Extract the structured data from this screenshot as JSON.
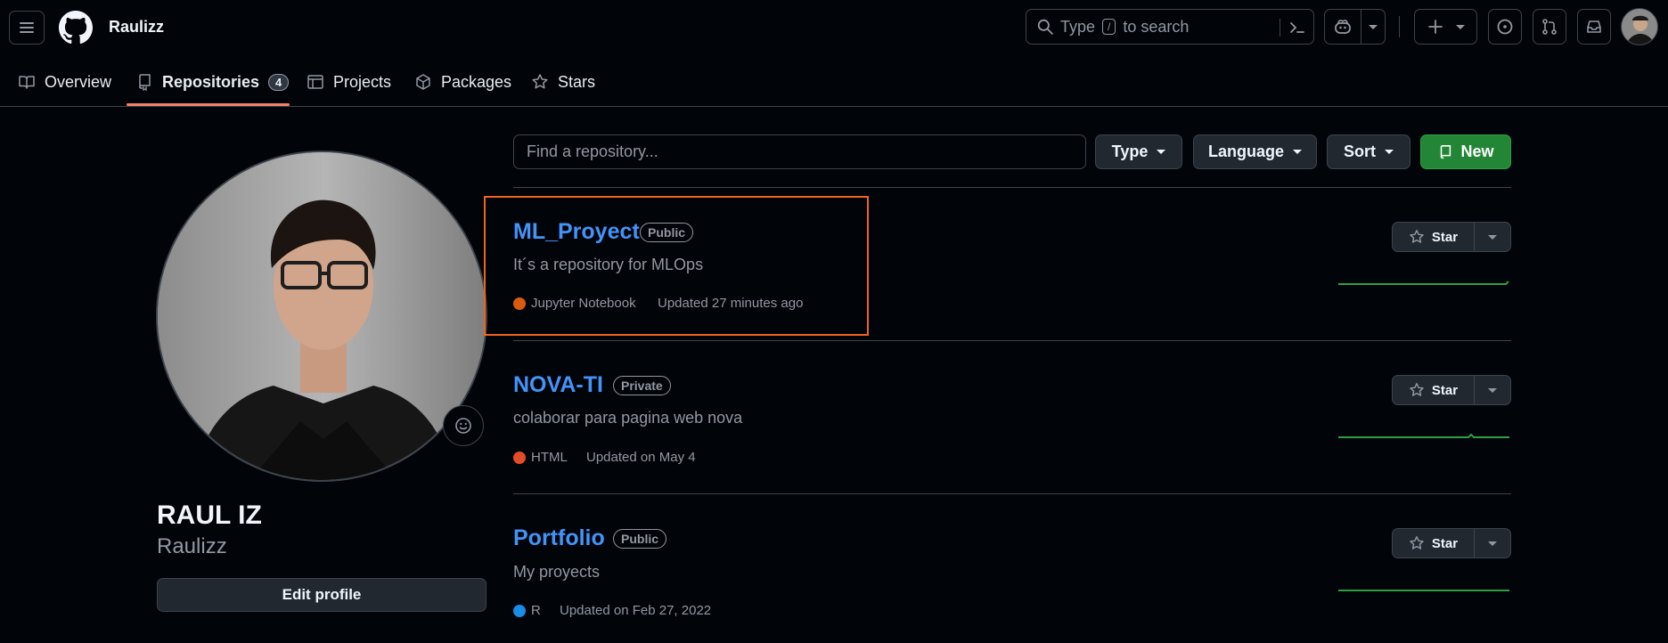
{
  "header": {
    "username": "Raulizz",
    "search_placeholder_pre": "Type",
    "search_key": "/",
    "search_placeholder_post": "to search"
  },
  "nav": {
    "overview": "Overview",
    "repositories": "Repositories",
    "repositories_count": "4",
    "projects": "Projects",
    "packages": "Packages",
    "stars": "Stars"
  },
  "profile": {
    "name": "RAUL IZ",
    "username": "Raulizz",
    "edit_button": "Edit profile"
  },
  "filters": {
    "find_placeholder": "Find a repository...",
    "type": "Type",
    "language": "Language",
    "sort": "Sort",
    "new": "New"
  },
  "repos": [
    {
      "name": "ML_Proyect",
      "visibility": "Public",
      "description": "It´s a repository for MLOps",
      "language": "Jupyter Notebook",
      "language_color": "#DA5B0B",
      "updated": "Updated 27 minutes ago",
      "star_label": "Star"
    },
    {
      "name": "NOVA-TI",
      "visibility": "Private",
      "description": "colaborar para pagina web nova",
      "language": "HTML",
      "language_color": "#e34c26",
      "updated": "Updated on May 4",
      "star_label": "Star"
    },
    {
      "name": "Portfolio",
      "visibility": "Public",
      "description": "My proyects",
      "language": "R",
      "language_color": "#198CE7",
      "updated": "Updated on Feb 27, 2022",
      "star_label": "Star"
    }
  ],
  "colors": {
    "accent_link": "#4493f8",
    "new_button": "#238636",
    "highlight_box": "#f0641e",
    "tab_underline": "#f78166"
  }
}
